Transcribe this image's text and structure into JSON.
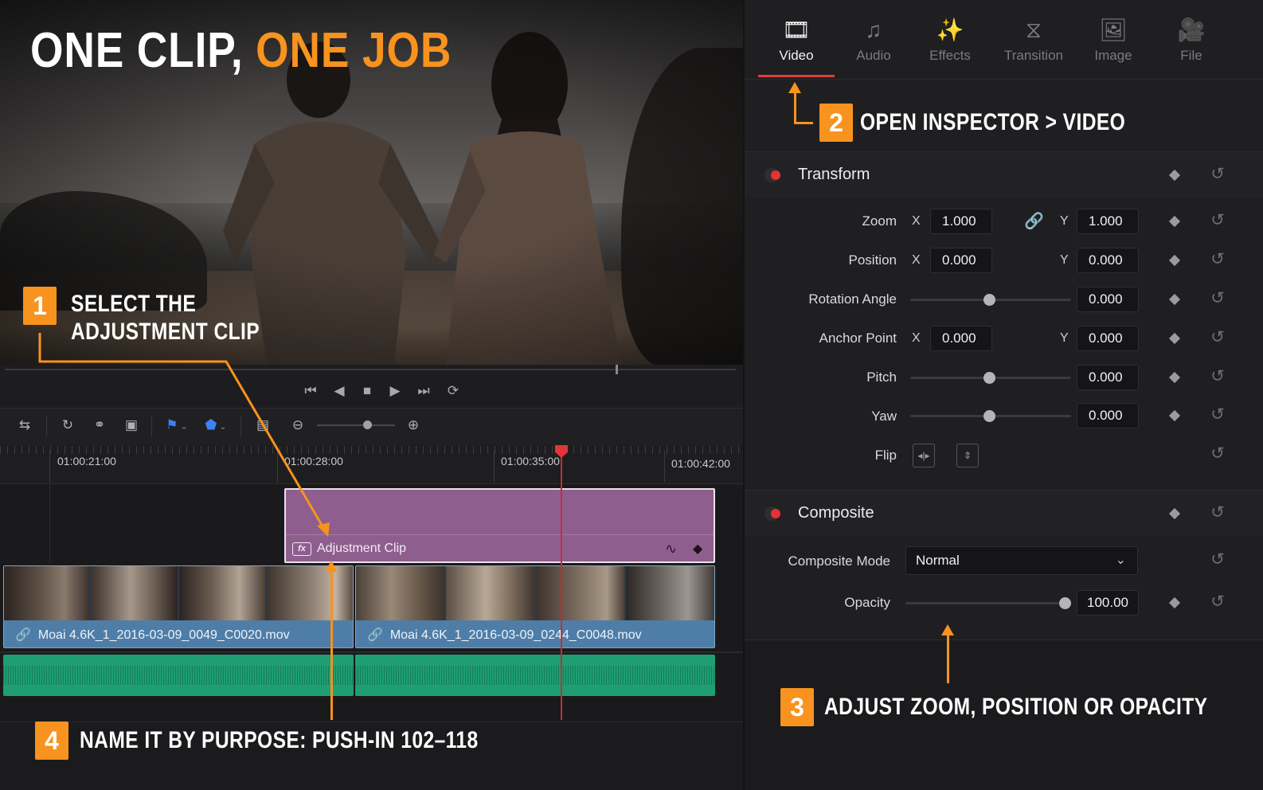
{
  "viewer": {
    "title_part1": "ONE CLIP, ",
    "title_part2": "ONE JOB"
  },
  "transport": {
    "icons": [
      "skip-to-start-icon",
      "step-back-icon",
      "stop-icon",
      "play-icon",
      "skip-to-end-icon",
      "loop-icon"
    ]
  },
  "toolbar": {
    "icons": [
      "trim-mode-icon",
      "snapping-icon",
      "linked-selection-icon",
      "position-lock-icon",
      "flag-icon",
      "marker-icon",
      "timeline-view-icon",
      "zoom-out-icon",
      "zoom-in-icon"
    ]
  },
  "timeline": {
    "timecodes": [
      "01:00:21:00",
      "01:00:28:00",
      "01:00:35:00",
      "01:00:42:00"
    ],
    "adjustment_clip": {
      "label": "Adjustment Clip",
      "icon_text": "fx"
    },
    "video_clips": [
      {
        "name": "Moai 4.6K_1_2016-03-09_0049_C0020.mov"
      },
      {
        "name": "Moai 4.6K_1_2016-03-09_0244_C0048.mov"
      }
    ]
  },
  "inspector": {
    "tabs": [
      {
        "label": "Video",
        "icon": "film-frame-icon",
        "active": true
      },
      {
        "label": "Audio",
        "icon": "music-note-icon",
        "active": false
      },
      {
        "label": "Effects",
        "icon": "magic-wand-icon",
        "active": false
      },
      {
        "label": "Transition",
        "icon": "transition-icon",
        "active": false
      },
      {
        "label": "Image",
        "icon": "image-icon",
        "active": false
      },
      {
        "label": "File",
        "icon": "file-camera-icon",
        "active": false
      }
    ],
    "transform": {
      "title": "Transform",
      "zoom": {
        "label": "Zoom",
        "x_axis": "X",
        "y_axis": "Y",
        "x": "1.000",
        "y": "1.000"
      },
      "position": {
        "label": "Position",
        "x_axis": "X",
        "y_axis": "Y",
        "x": "0.000",
        "y": "0.000"
      },
      "rotation": {
        "label": "Rotation Angle",
        "value": "0.000"
      },
      "anchor": {
        "label": "Anchor Point",
        "x_axis": "X",
        "y_axis": "Y",
        "x": "0.000",
        "y": "0.000"
      },
      "pitch": {
        "label": "Pitch",
        "value": "0.000"
      },
      "yaw": {
        "label": "Yaw",
        "value": "0.000"
      },
      "flip": {
        "label": "Flip"
      }
    },
    "composite": {
      "title": "Composite",
      "mode": {
        "label": "Composite Mode",
        "value": "Normal"
      },
      "opacity": {
        "label": "Opacity",
        "value": "100.00",
        "level": 1.0
      }
    }
  },
  "annotations": {
    "step1": {
      "number": "1",
      "line1": "SELECT THE",
      "line2": "ADJUSTMENT CLIP"
    },
    "step2": {
      "number": "2",
      "text": "OPEN INSPECTOR > VIDEO"
    },
    "step3": {
      "number": "3",
      "text": "ADJUST ZOOM, POSITION OR OPACITY"
    },
    "step4": {
      "number": "4",
      "text": "NAME IT BY PURPOSE: PUSH-IN 102–118"
    }
  },
  "colors": {
    "accent": "#f7931e",
    "adjustment_clip": "#8e5f8e",
    "video_clip": "#4e7ea8",
    "audio_clip": "#1f9e73",
    "playhead": "#e13636"
  }
}
